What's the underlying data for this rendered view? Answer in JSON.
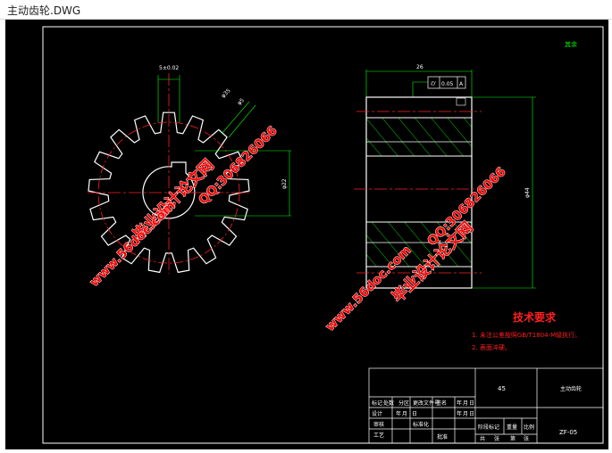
{
  "window": {
    "title": "主动齿轮.DWG"
  },
  "drawing": {
    "roughness_mark": "其余",
    "dims": {
      "tip_width": "5±0.02",
      "hub_dia": "φ22",
      "small_a": "φ35",
      "small_b": "φ5",
      "face_width": "26",
      "outer_dia": "φ44"
    },
    "gdt": {
      "symbol": "⌭",
      "value": "0.05",
      "datum": "A"
    },
    "requirements": {
      "heading": "技术要求",
      "items": [
        "1. 未注公差按照GB/T1804-M级执行。",
        "2. 表面淬硬。"
      ]
    },
    "title_block": {
      "material": "45",
      "part_name": "主动齿轮",
      "drawing_no": "ZF-05",
      "row1": [
        "标记",
        "处数",
        "分区",
        "更改文件号",
        "签名",
        "年",
        "月",
        "日"
      ],
      "row2": [
        "设计",
        "年",
        "月",
        "日",
        "标准化",
        "年",
        "月",
        "日"
      ],
      "row2_right": [
        "阶段标记",
        "重量",
        "比例"
      ],
      "row3": [
        "审核"
      ],
      "row4": [
        "工艺",
        "批准"
      ],
      "sheet": [
        "共",
        "张",
        "第",
        "张"
      ]
    },
    "watermarks": {
      "site": "毕业设计论文网",
      "url": "www.56doc.com",
      "qq": "QQ:306826066"
    }
  },
  "colors": {
    "background": "#000000",
    "outline": "#ffffff",
    "center_line": "#ff2020",
    "dimension": "#00ff00",
    "hatch": "#00ff00",
    "watermark": "#ff0000",
    "requirements": "#ff2020"
  }
}
